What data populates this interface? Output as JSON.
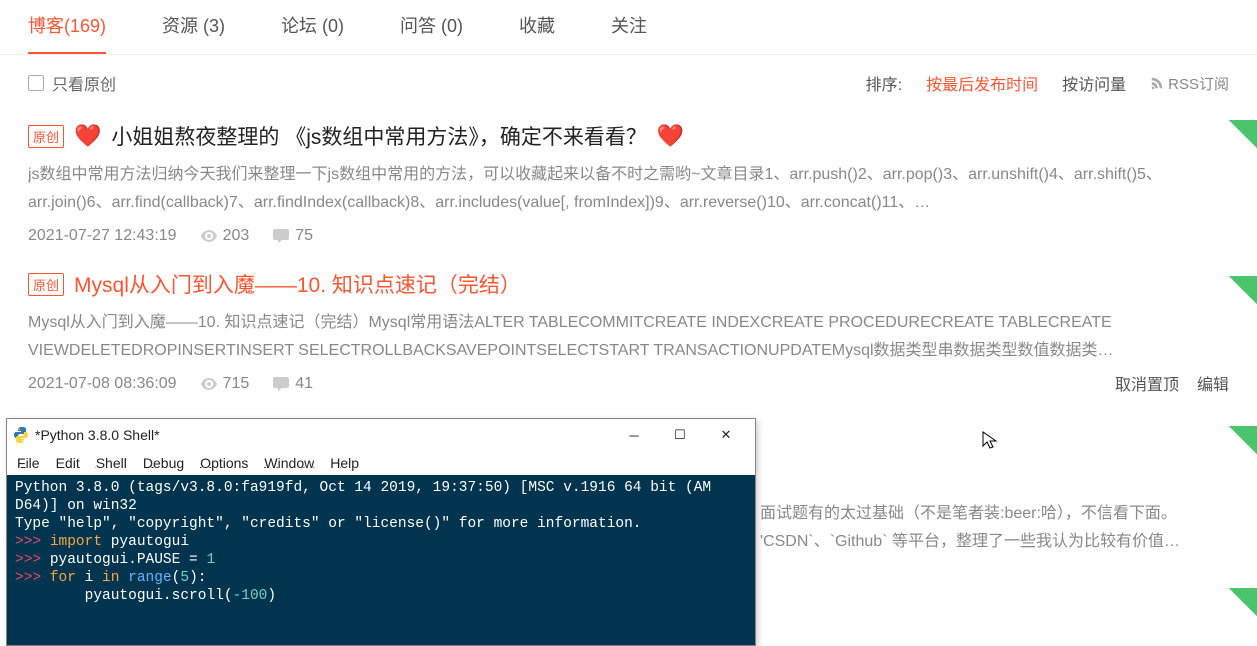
{
  "tabs": [
    {
      "label": "博客(169)",
      "active": true
    },
    {
      "label": "资源 (3)"
    },
    {
      "label": "论坛 (0)"
    },
    {
      "label": "问答 (0)"
    },
    {
      "label": "收藏"
    },
    {
      "label": "关注"
    }
  ],
  "filter": {
    "only_original": "只看原创"
  },
  "sort": {
    "label": "排序:",
    "by_time": "按最后发布时间",
    "by_views": "按访问量",
    "rss": "RSS订阅"
  },
  "articles": [
    {
      "badge": "原创",
      "title": "小姐姐熬夜整理的 《js数组中常用方法》，确定不来看看？",
      "hearts": true,
      "summary": "js数组中常用方法归纳今天我们来整理一下js数组中常用的方法，可以收藏起来以备不时之需哟~文章目录1、arr.push()2、arr.pop()3、arr.unshift()4、arr.shift()5、arr.join()6、arr.find(callback)7、arr.findIndex(callback)8、arr.includes(value[, fromIndex])9、arr.reverse()10、arr.concat()11、…",
      "time": "2021-07-27 12:43:19",
      "views": "203",
      "comments": "75"
    },
    {
      "badge": "原创",
      "title": "Mysql从入门到入魔——10. 知识点速记（完结）",
      "orange": true,
      "summary": "Mysql从入门到入魔——10. 知识点速记（完结）Mysql常用语法ALTER TABLECOMMITCREATE INDEXCREATE PROCEDURECREATE TABLECREATE VIEWDELETEDROPINSERTINSERT SELECTROLLBACKSAVEPOINTSELECTSTART TRANSACTIONUPDATEMysql数据类型串数据类型数值数据类…",
      "time": "2021-07-08 08:36:09",
      "views": "715",
      "comments": "41",
      "actions": {
        "unpin": "取消置顶",
        "edit": "编辑"
      }
    }
  ],
  "partial": {
    "line1": "面试题有的太过基础（不是笔者装:beer:哈），不信看下面。",
    "line2": "'CSDN`、`Github` 等平台，整理了一些我认为比较有价值…"
  },
  "shell": {
    "title": "*Python 3.8.0 Shell*",
    "menu": [
      "File",
      "Edit",
      "Shell",
      "Debug",
      "Options",
      "Window",
      "Help"
    ],
    "banner1": "Python 3.8.0 (tags/v3.8.0:fa919fd, Oct 14 2019, 19:37:50) [MSC v.1916 64 bit (AM",
    "banner2": "D64)] on win32",
    "banner3": "Type \"help\", \"copyright\", \"credits\" or \"license()\" for more information.",
    "lines": [
      {
        "prompt": ">>>",
        "code": "import pyautogui"
      },
      {
        "prompt": ">>>",
        "code": "pyautogui.PAUSE = 1"
      },
      {
        "prompt": ">>>",
        "code": "for i in range(5):"
      },
      {
        "prompt": "",
        "code": "        pyautogui.scroll(-100)"
      }
    ]
  }
}
